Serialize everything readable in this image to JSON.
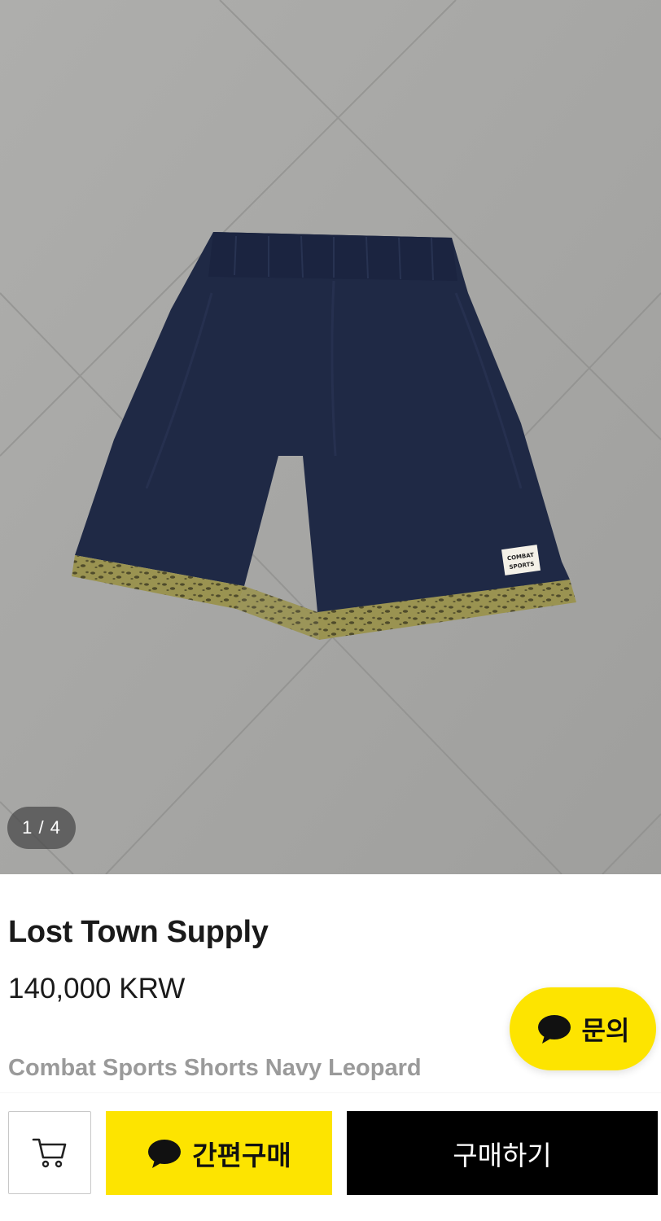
{
  "gallery": {
    "counter": "1 / 4",
    "image_alt": "navy shorts with leopard trim"
  },
  "product": {
    "brand": "Lost Town Supply",
    "price": "140,000 KRW",
    "name": "Combat Sports Shorts Navy Leopard"
  },
  "inquiry": {
    "label": "문의",
    "icon": "chat-bubble-icon"
  },
  "actions": {
    "cart_icon": "cart-icon",
    "quick_buy_label": "간편구매",
    "quick_buy_icon": "chat-bubble-icon",
    "buy_label": "구매하기"
  },
  "colors": {
    "accent_yellow": "#fde400",
    "buy_black": "#000000",
    "muted_text": "#9a9a9a"
  }
}
